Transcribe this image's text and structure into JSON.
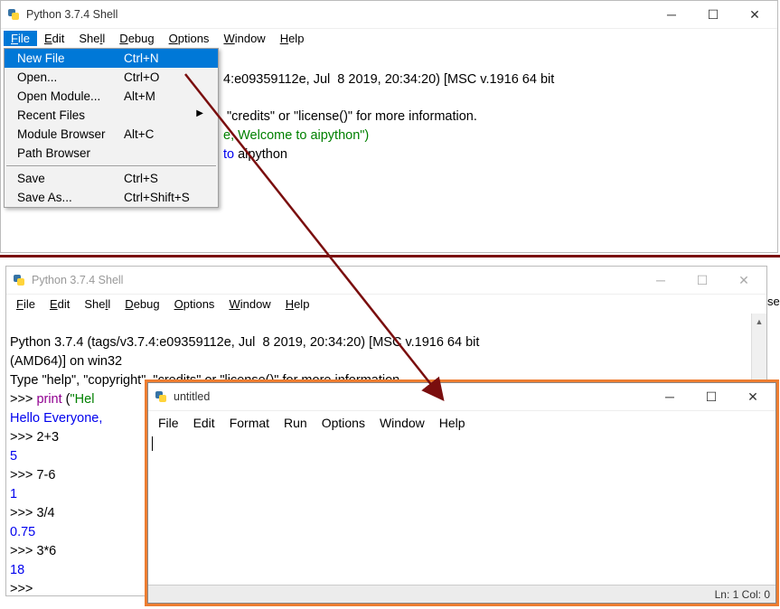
{
  "win1": {
    "title": "Python 3.7.4 Shell",
    "menus": {
      "file": "File",
      "edit": "Edit",
      "shell": "Shell",
      "debug": "Debug",
      "options": "Options",
      "window": "Window",
      "help": "Help"
    },
    "dropdown": {
      "new_file": "New File",
      "new_file_sc": "Ctrl+N",
      "open": "Open...",
      "open_sc": "Ctrl+O",
      "open_module": "Open Module...",
      "open_module_sc": "Alt+M",
      "recent": "Recent Files",
      "module_browser": "Module Browser",
      "module_browser_sc": "Alt+C",
      "path_browser": "Path Browser",
      "save": "Save",
      "save_sc": "Ctrl+S",
      "save_as": "Save As...",
      "save_as_sc": "Ctrl+Shift+S"
    },
    "body": {
      "frag1": "4:e09359112e, Jul  8 2019, 20:34:20) [MSC v.1916 64 bit",
      "frag2": " \"credits\" or \"license()\" for more information.",
      "frag3": "e, Welcome to aipython\")",
      "out1a": "to",
      "out1b": " aipython"
    }
  },
  "win2": {
    "title": "Python 3.7.4 Shell",
    "menus": {
      "file": "File",
      "edit": "Edit",
      "shell": "Shell",
      "debug": "Debug",
      "options": "Options",
      "window": "Window",
      "help": "Help"
    },
    "body": {
      "l1": "Python 3.7.4 (tags/v3.7.4:e09359112e, Jul  8 2019, 20:34:20) [MSC v.1916 64 bit",
      "l2": "(AMD64)] on win32",
      "l3": "Type \"help\", \"copyright\", \"credits\" or \"license()\" for more information.",
      "p": ">>> ",
      "print_kw": "print",
      "print_arg_open": " (",
      "print_str": "\"Hel",
      "out_hello": "Hello Everyone,",
      "e1": "2+3",
      "o1": "5",
      "e2": "7-6",
      "o2": "1",
      "e3": "3/4",
      "o3": "0.75",
      "e4": "3*6",
      "o4": "18"
    }
  },
  "win3": {
    "title": "untitled",
    "menus": {
      "file": "File",
      "edit": "Edit",
      "format": "Format",
      "run": "Run",
      "options": "Options",
      "window": "Window",
      "help": "Help"
    },
    "status": "Ln: 1  Col: 0"
  },
  "truncated_text": "ser"
}
